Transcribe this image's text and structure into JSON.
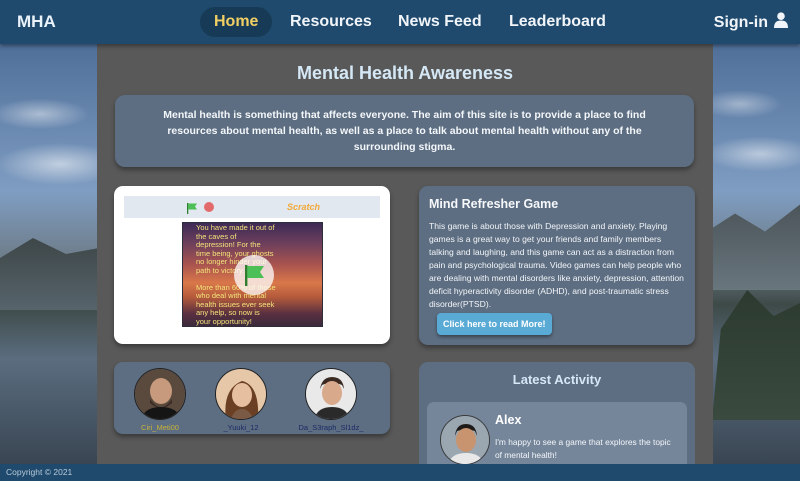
{
  "nav": {
    "brand": "MHA",
    "items": [
      {
        "label": "Home",
        "active": true
      },
      {
        "label": "Resources",
        "active": false
      },
      {
        "label": "News Feed",
        "active": false
      },
      {
        "label": "Leaderboard",
        "active": false
      }
    ],
    "signin": "Sign-in",
    "signin_icon": "user-icon"
  },
  "main": {
    "title": "Mental Health Awareness",
    "intro": "Mental health is something that affects everyone. The aim of this site is to provide a place to find resources about mental health, as well as a place to talk about mental health without any of the surrounding stigma."
  },
  "game": {
    "logo": "Scratch",
    "stage_paragraphs": [
      "You have made it out of the caves of depression! For the time being, your ghosts no longer hinder your path to victory.",
      "More than 60% of those who deal with mental health issues ever seek any help, so now is your opportunity!"
    ]
  },
  "members": [
    {
      "name": "Ciri_Meti00",
      "color": "#c9b13a"
    },
    {
      "name": "_Yuuki_12",
      "color": "#1a2a66"
    },
    {
      "name": "Da_S3raph_Sl1dz_",
      "color": "#1a2a66"
    }
  ],
  "mind": {
    "title": "Mind Refresher Game",
    "text": "This game is about those with Depression and anxiety. Playing games is a great way to get your friends and family members talking and laughing, and this game can act as a distraction from pain and psychological trauma. Video games can help people who are dealing with mental disorders like anxiety, depression, attention deficit hyperactivity disorder (ADHD), and post-traumatic stress disorder(PTSD).",
    "button": "Click here to read More!"
  },
  "activity": {
    "title": "Latest Activity",
    "post_name": "Alex",
    "post_text": "I'm happy to see a game that explores the topic of mental health!"
  },
  "footer": {
    "copyright": "Copyright © 2021"
  },
  "colors": {
    "nav": "#1f4a6d",
    "active_nav_text": "#f2cf63",
    "panel": "#595959",
    "card": "#5d6e82",
    "button": "#5aaad6"
  }
}
